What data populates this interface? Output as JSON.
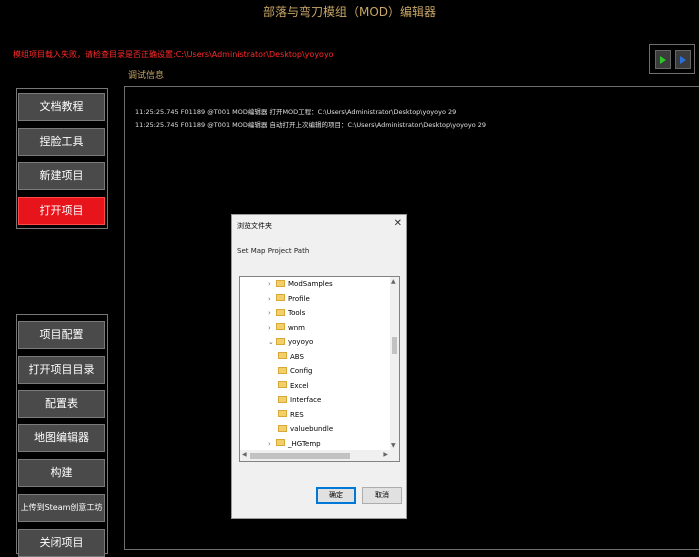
{
  "app": {
    "title": "部落与弯刀模组（MOD）编辑器"
  },
  "warning": "模组项目载入失败，请检查目录是否正确设置:C:\\Users\\Administrator\\Desktop\\yoyoyo",
  "debug": {
    "label": "调试信息",
    "logs": [
      "11:25:25.745 F01189 @T001 MOD编辑器    打开MOD工程：C:\\Users\\Administrator\\Desktop\\yoyoyo 29",
      "11:25:25.745 F01189 @T001 MOD编辑器    自动打开上次编辑的项目：C:\\Users\\Administrator\\Desktop\\yoyoyo 29"
    ]
  },
  "sidebar": {
    "top": [
      "文档教程",
      "捏脸工具",
      "新建项目",
      "打开项目"
    ],
    "bottom": [
      "项目配置",
      "打开项目目录",
      "配置表",
      "地图编辑器",
      "构建",
      "上传到Steam创意工坊",
      "关闭项目"
    ],
    "active": "打开项目"
  },
  "dialog": {
    "title": "浏览文件夹",
    "close": "✕",
    "description": "Set Map Project Path",
    "tree": [
      {
        "label": "ModSamples",
        "chevron": "›",
        "level": 0
      },
      {
        "label": "Profile",
        "chevron": "›",
        "level": 0
      },
      {
        "label": "Tools",
        "chevron": "›",
        "level": 0
      },
      {
        "label": "wnm",
        "chevron": "›",
        "level": 0
      },
      {
        "label": "yoyoyo",
        "chevron": "⌄",
        "level": 0
      },
      {
        "label": "ABS",
        "chevron": "",
        "level": 1
      },
      {
        "label": "Config",
        "chevron": "",
        "level": 1
      },
      {
        "label": "Excel",
        "chevron": "",
        "level": 1
      },
      {
        "label": "Interface",
        "chevron": "",
        "level": 1
      },
      {
        "label": "RES",
        "chevron": "",
        "level": 1
      },
      {
        "label": "valuebundle",
        "chevron": "",
        "level": 1
      },
      {
        "label": "_HGTemp",
        "chevron": "›",
        "level": 0
      }
    ],
    "ok": "确定",
    "cancel": "取消"
  },
  "colors": {
    "accent": "#c8a666",
    "active": "#e8141c",
    "warning": "#ff2a2a",
    "folder": "#f3cf6a"
  }
}
